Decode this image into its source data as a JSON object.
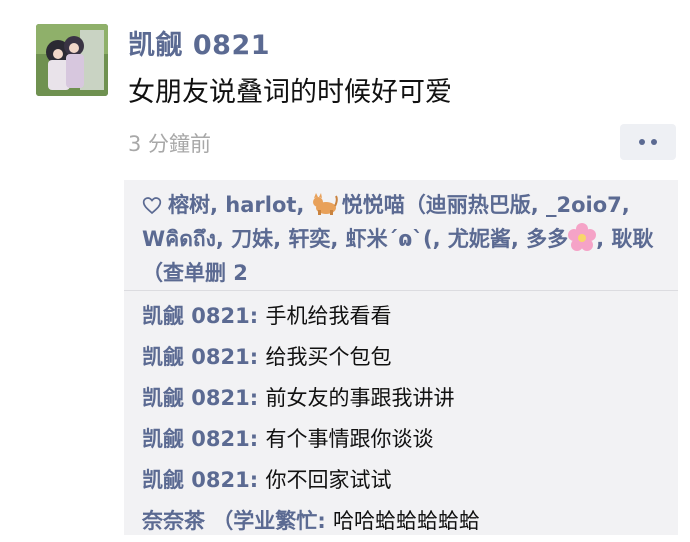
{
  "post": {
    "author": "凯觎 0821",
    "text": "女朋友说叠词的时候好可爱",
    "time": "3 分鐘前"
  },
  "likes": {
    "part1": "榕树, harlot, ",
    "part2": "悦悦喵（迪丽热巴版, _2oio7, Wคิดถึง, 刀妹, 轩奕, 虾米ˊɷˋ(, 尤妮酱, 多多",
    "part3": ", 耿耿（查单删 2"
  },
  "comments": [
    {
      "name": "凯觎 0821",
      "text": "手机给我看看"
    },
    {
      "name": "凯觎 0821",
      "text": "给我买个包包"
    },
    {
      "name": "凯觎 0821",
      "text": "前女友的事跟我讲讲"
    },
    {
      "name": "凯觎 0821",
      "text": "有个事情跟你谈谈"
    },
    {
      "name": "凯觎 0821",
      "text": "你不回家试试"
    },
    {
      "name": "奈奈茶 （学业繁忙",
      "text": "哈哈蛤蛤蛤蛤蛤"
    }
  ],
  "colors": {
    "name_blue": "#5b6a92",
    "panel_bg": "#f2f2f4",
    "time_gray": "#a8a8a8"
  },
  "icons": [
    "avatar-image",
    "heart-icon",
    "cat-emoji-icon",
    "cherry-blossom-emoji-icon",
    "more-options-icon"
  ]
}
